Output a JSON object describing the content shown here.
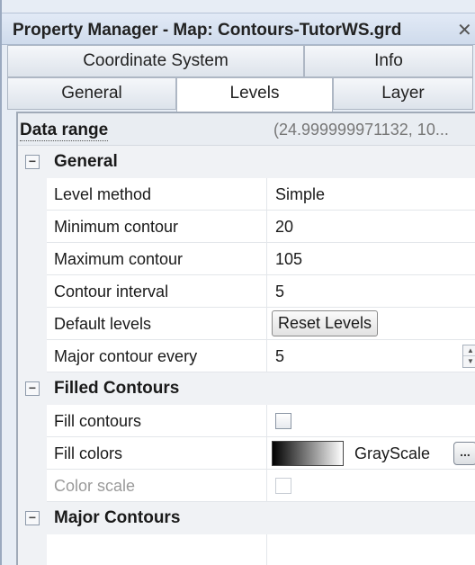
{
  "window": {
    "title": "Property Manager - Map: Contours-TutorWS.grd",
    "close_icon": "close-icon"
  },
  "tabs": {
    "row1": [
      {
        "label": "Coordinate System"
      },
      {
        "label": "Info"
      }
    ],
    "row2": [
      {
        "label": "General"
      },
      {
        "label": "Levels",
        "active": true
      },
      {
        "label": "Layer"
      }
    ]
  },
  "data_range": {
    "label": "Data range",
    "value": "(24.999999971132, 10..."
  },
  "sections": {
    "general": {
      "title": "General",
      "toggle": "−",
      "level_method": {
        "label": "Level method",
        "value": "Simple"
      },
      "minimum_contour": {
        "label": "Minimum contour",
        "value": "20"
      },
      "maximum_contour": {
        "label": "Maximum contour",
        "value": "105"
      },
      "contour_interval": {
        "label": "Contour interval",
        "value": "5"
      },
      "default_levels": {
        "label": "Default levels",
        "button": "Reset Levels"
      },
      "major_contour_every": {
        "label": "Major contour every",
        "value": "5"
      }
    },
    "filled_contours": {
      "title": "Filled Contours",
      "toggle": "−",
      "fill_contours": {
        "label": "Fill contours",
        "checked": false
      },
      "fill_colors": {
        "label": "Fill colors",
        "value": "GrayScale",
        "button": "..."
      },
      "color_scale": {
        "label": "Color scale",
        "checked": false,
        "disabled": true
      }
    },
    "major_contours": {
      "title": "Major Contours",
      "toggle": "−"
    }
  },
  "spinner": {
    "up": "▲",
    "down": "▼"
  },
  "colors": {
    "title_bar": "#d6e1ef",
    "category_row": "#f0f2f5",
    "grid_line": "#e3e6ea",
    "disabled_text": "#9a9a9a"
  }
}
